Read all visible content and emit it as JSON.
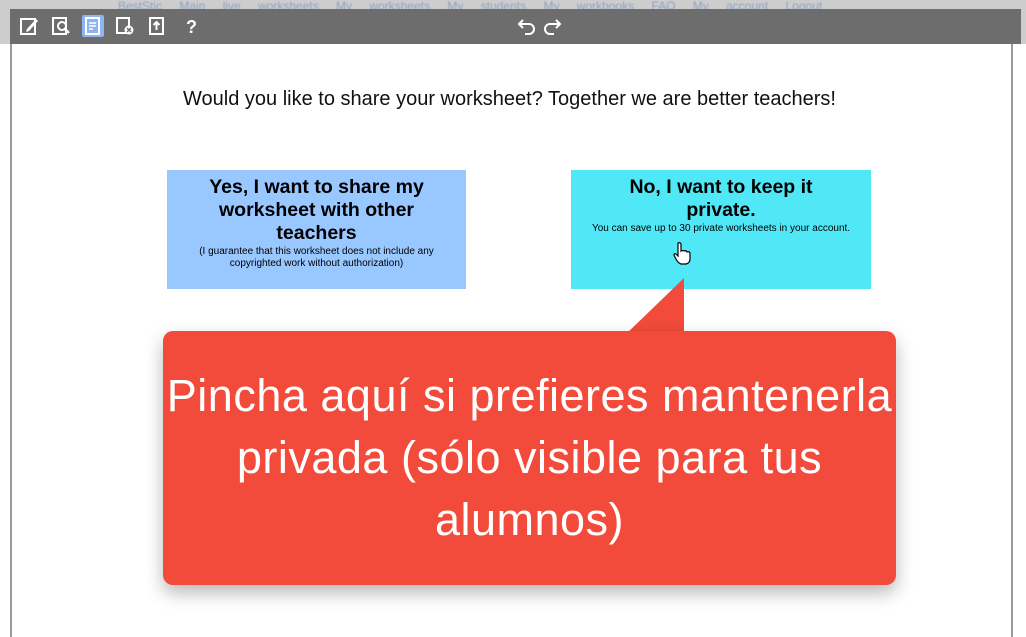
{
  "nav": {
    "links": "BestStic Main  live worksheets  My worksheets  My students  My workbooks  FAQ  My account  Logout"
  },
  "toolbar": {
    "icons": [
      "edit-icon",
      "preview-icon",
      "save-icon",
      "delete-icon",
      "export-icon"
    ],
    "help_label": "?",
    "undo_icon": "undo-icon",
    "redo_icon": "redo-icon"
  },
  "share_dialog": {
    "prompt": "Would you like to share your worksheet? Together we are better teachers!",
    "share_option": {
      "title": "Yes, I want to share my worksheet with other teachers",
      "note": "(I guarantee that this worksheet does not include any copyrighted work without authorization)",
      "color": "#99c7ff"
    },
    "private_option": {
      "title": "No, I want to keep it private.",
      "note": "You can save up to 30 private worksheets in your account.",
      "color": "#50e8f6"
    }
  },
  "callout": {
    "text": "Pincha aquí si prefieres mantenerla privada (sólo visible para tus alumnos)",
    "color": "#f24b3b"
  }
}
